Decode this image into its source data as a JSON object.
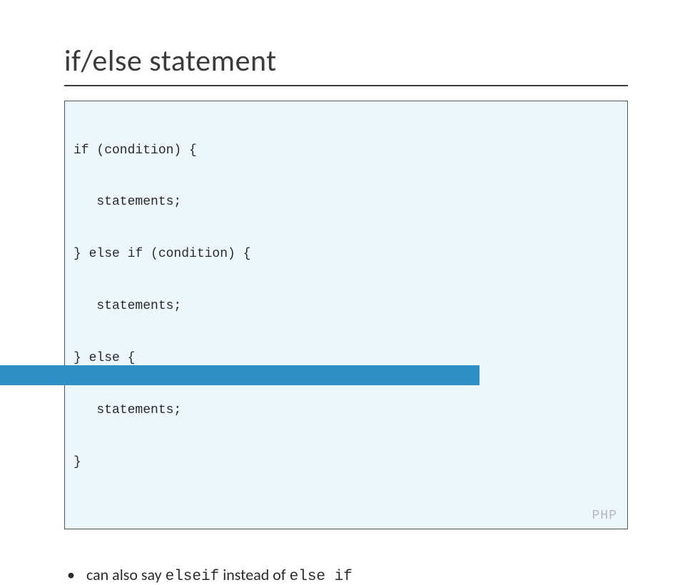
{
  "title": "if/else statement",
  "code": {
    "lines": [
      "if (condition) {",
      "   statements;",
      "} else if (condition) {",
      "   statements;",
      "} else {",
      "   statements;",
      "}"
    ],
    "lang": "PHP"
  },
  "bullet": {
    "marker": "•",
    "prefix": "can also say ",
    "mono1": "elseif",
    "mid": " instead of ",
    "mono2": "else if"
  }
}
